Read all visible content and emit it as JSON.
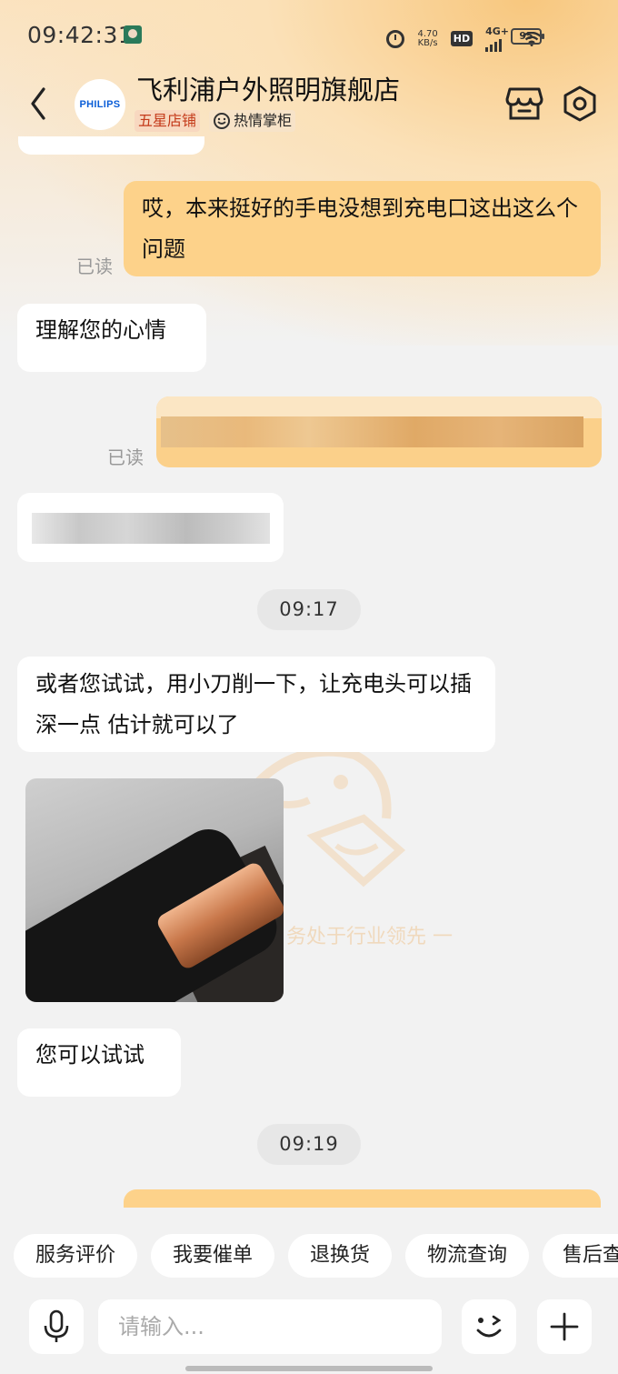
{
  "status_bar": {
    "time": "09:42:31",
    "speed_value": "4.70",
    "speed_unit": "KB/s",
    "hd": "HD",
    "network": "4G+",
    "battery": "95"
  },
  "header": {
    "shop_name": "飞利浦户外照明旗舰店",
    "logo_text": "PHILIPS",
    "badge_star": "五星店铺",
    "badge_warm": "热情掌柜"
  },
  "messages": {
    "m1_text": "哎，本来挺好的手电没想到充电口这出这么个问题",
    "m1_status": "已读",
    "m2_text": "理解您的心情",
    "m3_status": "已读",
    "time1": "09:17",
    "m5_text": "或者您试试，用小刀削一下，让充电头可以插深一点  估计就可以了",
    "m7_text": "您可以试试",
    "time2": "09:19"
  },
  "watermark": {
    "text": "务处于行业领先  一"
  },
  "quick_actions": [
    "服务评价",
    "我要催单",
    "退换货",
    "物流查询",
    "售后查"
  ],
  "input": {
    "placeholder": "请输入..."
  }
}
